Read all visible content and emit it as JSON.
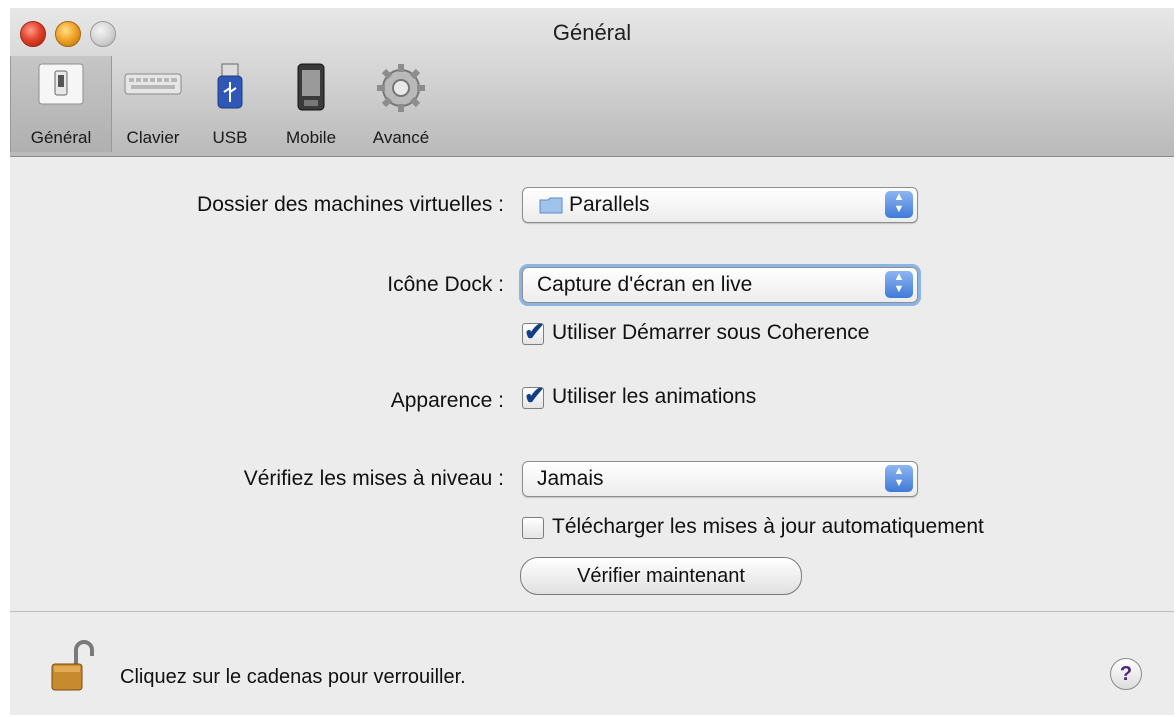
{
  "window": {
    "title": "Général"
  },
  "toolbar": {
    "items": [
      {
        "label": "Général",
        "icon": "general-switch-icon",
        "selected": true
      },
      {
        "label": "Clavier",
        "icon": "keyboard-icon",
        "selected": false
      },
      {
        "label": "USB",
        "icon": "usb-icon",
        "selected": false
      },
      {
        "label": "Mobile",
        "icon": "mobile-device-icon",
        "selected": false
      },
      {
        "label": "Avancé",
        "icon": "gear-icon",
        "selected": false
      }
    ]
  },
  "settings": {
    "vm_folder": {
      "label": "Dossier des machines virtuelles :",
      "value": "Parallels",
      "icon": "folder-icon"
    },
    "dock_icon": {
      "label": "Icône Dock :",
      "value": "Capture d'écran en live",
      "checkbox_label": "Utiliser Démarrer sous Coherence",
      "checkbox_checked": true
    },
    "appearance": {
      "label": "Apparence :",
      "checkbox_label": "Utiliser les animations",
      "checkbox_checked": true
    },
    "updates": {
      "label": "Vérifiez les mises à niveau :",
      "value": "Jamais",
      "checkbox_label": "Télécharger les mises à jour automatiquement",
      "checkbox_checked": false,
      "button_label": "Vérifier maintenant"
    }
  },
  "footer": {
    "lock_text": "Cliquez sur le cadenas pour verrouiller.",
    "help_label": "?"
  },
  "colors": {
    "popup_arrow": "#3f7ad8",
    "focus_ring": "#8ab3e6",
    "checkmark": "#123e86"
  }
}
